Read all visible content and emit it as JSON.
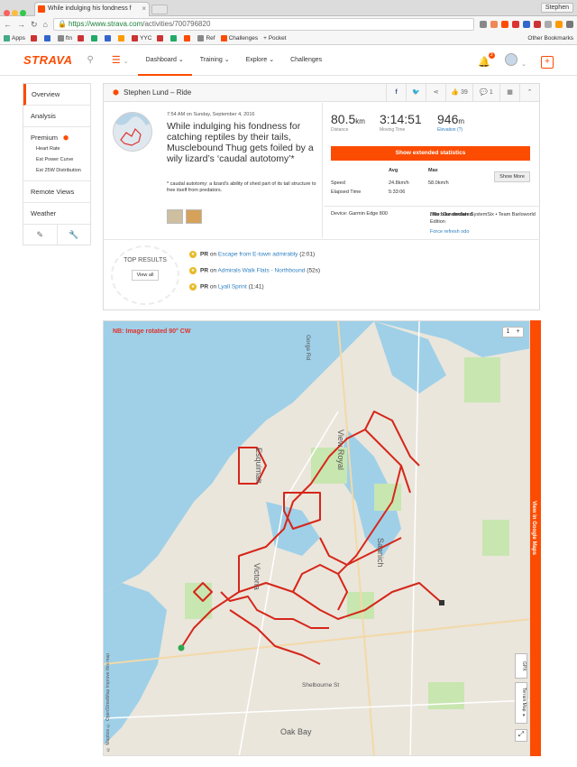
{
  "browser": {
    "tab_title": "While indulging his fondness f",
    "user": "Stephen",
    "url_domain": "https://www.strava.com",
    "url_path": "/activities/700796820",
    "bookmarks": [
      "Apps",
      "ftn",
      "YYC",
      "Ref",
      "Challenges",
      "+ Pocket"
    ],
    "other_bookmarks": "Other Bookmarks"
  },
  "nav": {
    "logo": "STRAVA",
    "links": [
      "Dashboard",
      "Training",
      "Explore",
      "Challenges"
    ],
    "notification_count": "3"
  },
  "sidebar": {
    "overview": "Overview",
    "analysis": "Analysis",
    "premium": "Premium",
    "sub": [
      "Heart Rate",
      "Est Power Curve",
      "Est 25W Distribution"
    ],
    "remote_views": "Remote Views",
    "weather": "Weather"
  },
  "activity": {
    "header": "Stephen Lund – Ride",
    "kudos": "39",
    "comments": "1",
    "datetime": "7:54 AM on Sunday, September 4, 2016",
    "title": "While indulging his fondness for catching reptiles by their tails, Musclebound Thug gets foiled by a wily lizard’s ‘caudal autotomy’*",
    "description": "* caudal autotomy: a lizard’s ability of shed part of its tail structure to free itself from predators.",
    "stats": {
      "distance_val": "80.5",
      "distance_unit": "km",
      "distance_label": "Distance",
      "time_val": "3:14:51",
      "time_label": "Moving Time",
      "elev_val": "946",
      "elev_unit": "m",
      "elev_label": "Elevation (?)"
    },
    "extended_btn": "Show extended statistics",
    "table": {
      "avg": "Avg",
      "max": "Max",
      "show_more": "Show More",
      "speed_label": "Speed",
      "speed_avg": "24.8km/h",
      "speed_max": "58.0km/h",
      "elapsed_label": "Elapsed Time",
      "elapsed_val": "5:33:06"
    },
    "device": "Device: Garmin Edge 800",
    "bike": "Bike: Cannondale SystemSix • Team Barloworld Edition",
    "no_bike": "/ No bike declared",
    "refresh": "Force refresh odo"
  },
  "top_results": {
    "title": "TOP RESULTS",
    "view_all": "View all",
    "items": [
      {
        "pr": "PR",
        "on": "on",
        "segment": "Escape from E-town admirably",
        "time": "(2:01)"
      },
      {
        "pr": "PR",
        "on": "on",
        "segment": "Admirals Walk Flats - Northbound",
        "time": "(52s)"
      },
      {
        "pr": "PR",
        "on": "on",
        "segment": "Lyall Sprint",
        "time": "(1:41)"
      }
    ]
  },
  "map": {
    "note": "NB: Image rotated 90° CW",
    "view_google": "View in Google Maps",
    "gpx": "GPX",
    "terrain": "Terrain Map ▾",
    "attribution": "© Mapbox © OpenStreetMap Improve this map",
    "places": [
      "View Royal",
      "Saanich",
      "Victoria",
      "Esquimalt",
      "Oak Bay",
      "Gorge Rd",
      "Shelbourne St"
    ],
    "zoom": "1"
  }
}
